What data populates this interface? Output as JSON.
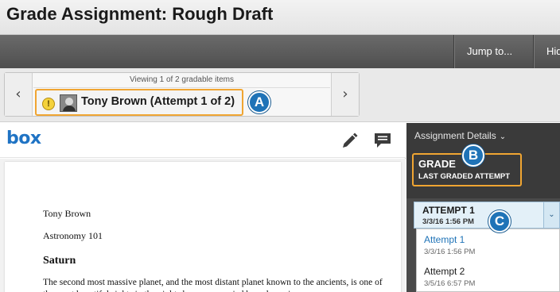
{
  "header": {
    "title": "Grade Assignment: Rough Draft"
  },
  "actionbar": {
    "jump_label": "Jump to...",
    "hide_label": "Hid"
  },
  "navigator": {
    "viewing_text": "Viewing 1 of 2 gradable items",
    "prev_glyph": "‹",
    "next_glyph": "›",
    "student_label": "Tony Brown (Attempt 1 of 2)",
    "alert_glyph": "!"
  },
  "markers": {
    "a": "A",
    "b": "B",
    "c": "C"
  },
  "viewer": {
    "logo": "box",
    "icons": [
      "pencil-icon",
      "comment-icon"
    ],
    "document": {
      "name": "Tony Brown",
      "course": "Astronomy 101",
      "heading": "Saturn",
      "body": "The second most massive planet, and the most distant planet known to the ancients, is one of the most beautiful sights in the night sky, accompanied by a dozen images"
    }
  },
  "sidepanel": {
    "details_label": "Assignment Details",
    "details_glyph": "⌄",
    "grade_title": "GRADE",
    "grade_subtitle": "LAST GRADED ATTEMPT",
    "attempt_selected": {
      "label": "ATTEMPT 1",
      "date": "3/3/16 1:56 PM",
      "toggle_glyph": "⌄"
    },
    "attempt_options": [
      {
        "label": "Attempt 1",
        "date": "3/3/16 1:56 PM"
      },
      {
        "label": "Attempt 2",
        "date": "3/5/16 6:57 PM"
      }
    ]
  },
  "colors": {
    "accent_blue": "#1f73b7",
    "highlight_orange": "#f0a532",
    "panel_dark": "#3a3a3a"
  }
}
